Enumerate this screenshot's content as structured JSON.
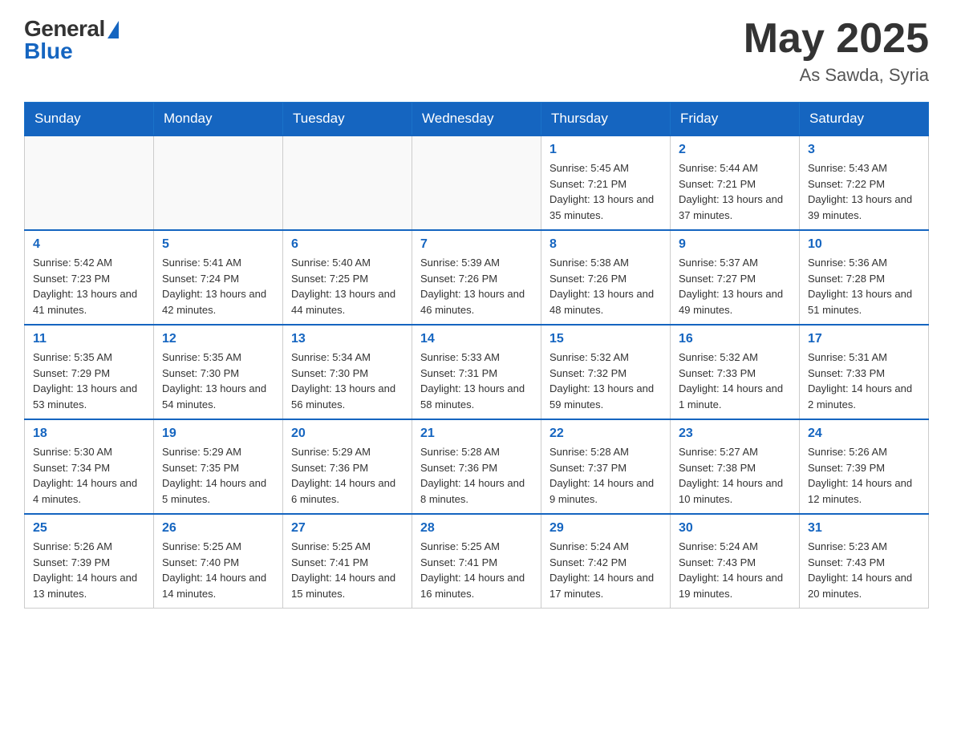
{
  "header": {
    "logo": {
      "general_text": "General",
      "blue_text": "Blue"
    },
    "title": "May 2025",
    "location": "As Sawda, Syria"
  },
  "days_of_week": [
    "Sunday",
    "Monday",
    "Tuesday",
    "Wednesday",
    "Thursday",
    "Friday",
    "Saturday"
  ],
  "weeks": [
    [
      {
        "day": "",
        "sunrise": "",
        "sunset": "",
        "daylight": ""
      },
      {
        "day": "",
        "sunrise": "",
        "sunset": "",
        "daylight": ""
      },
      {
        "day": "",
        "sunrise": "",
        "sunset": "",
        "daylight": ""
      },
      {
        "day": "",
        "sunrise": "",
        "sunset": "",
        "daylight": ""
      },
      {
        "day": "1",
        "sunrise": "Sunrise: 5:45 AM",
        "sunset": "Sunset: 7:21 PM",
        "daylight": "Daylight: 13 hours and 35 minutes."
      },
      {
        "day": "2",
        "sunrise": "Sunrise: 5:44 AM",
        "sunset": "Sunset: 7:21 PM",
        "daylight": "Daylight: 13 hours and 37 minutes."
      },
      {
        "day": "3",
        "sunrise": "Sunrise: 5:43 AM",
        "sunset": "Sunset: 7:22 PM",
        "daylight": "Daylight: 13 hours and 39 minutes."
      }
    ],
    [
      {
        "day": "4",
        "sunrise": "Sunrise: 5:42 AM",
        "sunset": "Sunset: 7:23 PM",
        "daylight": "Daylight: 13 hours and 41 minutes."
      },
      {
        "day": "5",
        "sunrise": "Sunrise: 5:41 AM",
        "sunset": "Sunset: 7:24 PM",
        "daylight": "Daylight: 13 hours and 42 minutes."
      },
      {
        "day": "6",
        "sunrise": "Sunrise: 5:40 AM",
        "sunset": "Sunset: 7:25 PM",
        "daylight": "Daylight: 13 hours and 44 minutes."
      },
      {
        "day": "7",
        "sunrise": "Sunrise: 5:39 AM",
        "sunset": "Sunset: 7:26 PM",
        "daylight": "Daylight: 13 hours and 46 minutes."
      },
      {
        "day": "8",
        "sunrise": "Sunrise: 5:38 AM",
        "sunset": "Sunset: 7:26 PM",
        "daylight": "Daylight: 13 hours and 48 minutes."
      },
      {
        "day": "9",
        "sunrise": "Sunrise: 5:37 AM",
        "sunset": "Sunset: 7:27 PM",
        "daylight": "Daylight: 13 hours and 49 minutes."
      },
      {
        "day": "10",
        "sunrise": "Sunrise: 5:36 AM",
        "sunset": "Sunset: 7:28 PM",
        "daylight": "Daylight: 13 hours and 51 minutes."
      }
    ],
    [
      {
        "day": "11",
        "sunrise": "Sunrise: 5:35 AM",
        "sunset": "Sunset: 7:29 PM",
        "daylight": "Daylight: 13 hours and 53 minutes."
      },
      {
        "day": "12",
        "sunrise": "Sunrise: 5:35 AM",
        "sunset": "Sunset: 7:30 PM",
        "daylight": "Daylight: 13 hours and 54 minutes."
      },
      {
        "day": "13",
        "sunrise": "Sunrise: 5:34 AM",
        "sunset": "Sunset: 7:30 PM",
        "daylight": "Daylight: 13 hours and 56 minutes."
      },
      {
        "day": "14",
        "sunrise": "Sunrise: 5:33 AM",
        "sunset": "Sunset: 7:31 PM",
        "daylight": "Daylight: 13 hours and 58 minutes."
      },
      {
        "day": "15",
        "sunrise": "Sunrise: 5:32 AM",
        "sunset": "Sunset: 7:32 PM",
        "daylight": "Daylight: 13 hours and 59 minutes."
      },
      {
        "day": "16",
        "sunrise": "Sunrise: 5:32 AM",
        "sunset": "Sunset: 7:33 PM",
        "daylight": "Daylight: 14 hours and 1 minute."
      },
      {
        "day": "17",
        "sunrise": "Sunrise: 5:31 AM",
        "sunset": "Sunset: 7:33 PM",
        "daylight": "Daylight: 14 hours and 2 minutes."
      }
    ],
    [
      {
        "day": "18",
        "sunrise": "Sunrise: 5:30 AM",
        "sunset": "Sunset: 7:34 PM",
        "daylight": "Daylight: 14 hours and 4 minutes."
      },
      {
        "day": "19",
        "sunrise": "Sunrise: 5:29 AM",
        "sunset": "Sunset: 7:35 PM",
        "daylight": "Daylight: 14 hours and 5 minutes."
      },
      {
        "day": "20",
        "sunrise": "Sunrise: 5:29 AM",
        "sunset": "Sunset: 7:36 PM",
        "daylight": "Daylight: 14 hours and 6 minutes."
      },
      {
        "day": "21",
        "sunrise": "Sunrise: 5:28 AM",
        "sunset": "Sunset: 7:36 PM",
        "daylight": "Daylight: 14 hours and 8 minutes."
      },
      {
        "day": "22",
        "sunrise": "Sunrise: 5:28 AM",
        "sunset": "Sunset: 7:37 PM",
        "daylight": "Daylight: 14 hours and 9 minutes."
      },
      {
        "day": "23",
        "sunrise": "Sunrise: 5:27 AM",
        "sunset": "Sunset: 7:38 PM",
        "daylight": "Daylight: 14 hours and 10 minutes."
      },
      {
        "day": "24",
        "sunrise": "Sunrise: 5:26 AM",
        "sunset": "Sunset: 7:39 PM",
        "daylight": "Daylight: 14 hours and 12 minutes."
      }
    ],
    [
      {
        "day": "25",
        "sunrise": "Sunrise: 5:26 AM",
        "sunset": "Sunset: 7:39 PM",
        "daylight": "Daylight: 14 hours and 13 minutes."
      },
      {
        "day": "26",
        "sunrise": "Sunrise: 5:25 AM",
        "sunset": "Sunset: 7:40 PM",
        "daylight": "Daylight: 14 hours and 14 minutes."
      },
      {
        "day": "27",
        "sunrise": "Sunrise: 5:25 AM",
        "sunset": "Sunset: 7:41 PM",
        "daylight": "Daylight: 14 hours and 15 minutes."
      },
      {
        "day": "28",
        "sunrise": "Sunrise: 5:25 AM",
        "sunset": "Sunset: 7:41 PM",
        "daylight": "Daylight: 14 hours and 16 minutes."
      },
      {
        "day": "29",
        "sunrise": "Sunrise: 5:24 AM",
        "sunset": "Sunset: 7:42 PM",
        "daylight": "Daylight: 14 hours and 17 minutes."
      },
      {
        "day": "30",
        "sunrise": "Sunrise: 5:24 AM",
        "sunset": "Sunset: 7:43 PM",
        "daylight": "Daylight: 14 hours and 19 minutes."
      },
      {
        "day": "31",
        "sunrise": "Sunrise: 5:23 AM",
        "sunset": "Sunset: 7:43 PM",
        "daylight": "Daylight: 14 hours and 20 minutes."
      }
    ]
  ]
}
